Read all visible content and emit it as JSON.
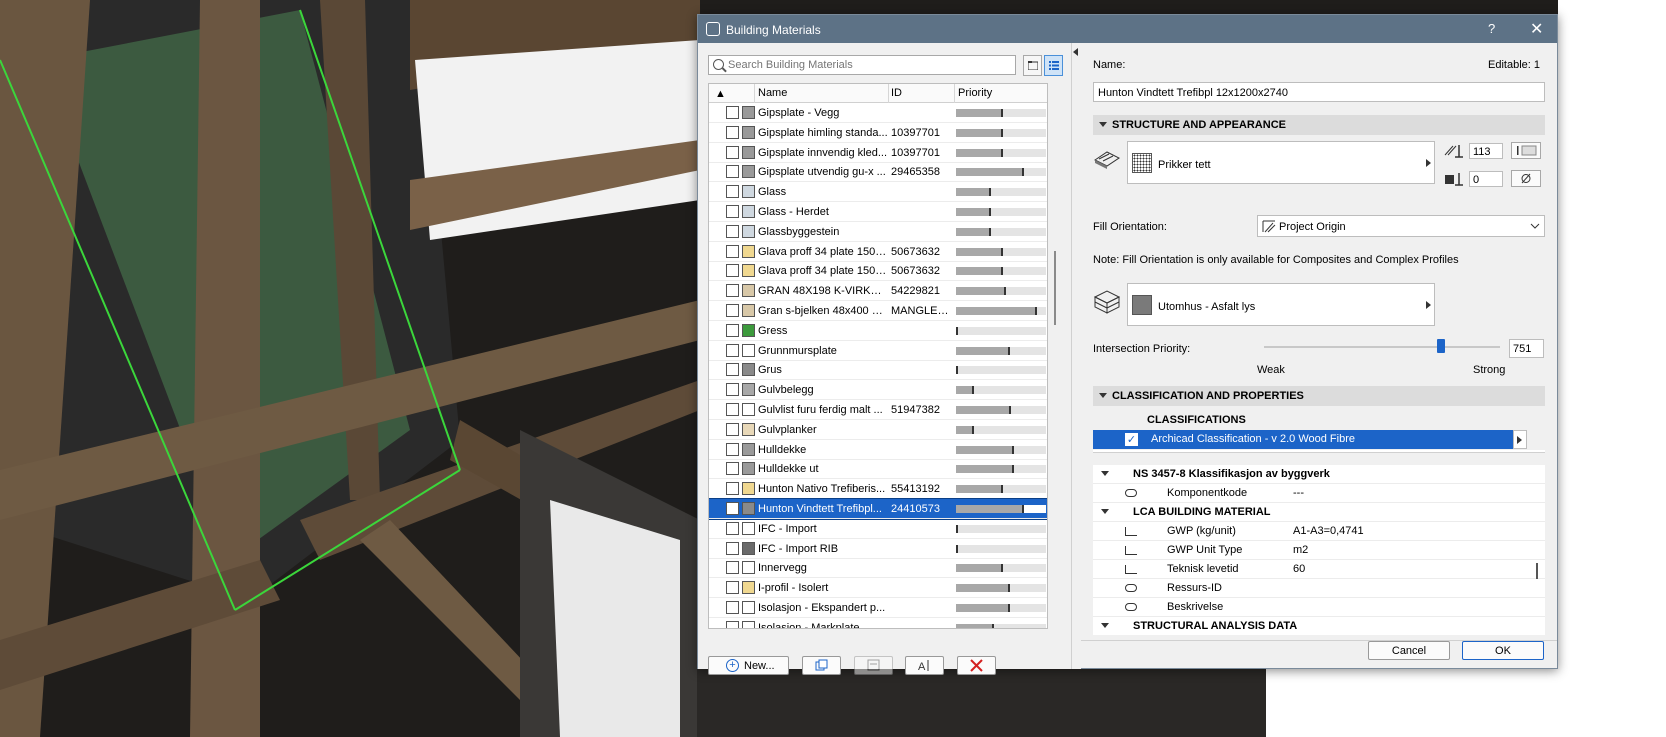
{
  "window": {
    "title": "Building Materials",
    "help": "?",
    "close": "✕"
  },
  "search": {
    "placeholder": "Search Building Materials"
  },
  "list": {
    "headers": {
      "name": "Name",
      "id": "ID",
      "priority": "Priority"
    },
    "rows": [
      {
        "name": "Gipsplate - Vegg",
        "id": "",
        "priority": 0.52,
        "color": "#9a9a9a"
      },
      {
        "name": "Gipsplate himling standa...",
        "id": "10397701",
        "priority": 0.52,
        "color": "#9a9a9a"
      },
      {
        "name": "Gipsplate innvendig kled...",
        "id": "10397701",
        "priority": 0.52,
        "color": "#9a9a9a"
      },
      {
        "name": "Gipsplate utvendig gu-x ...",
        "id": "29465358",
        "priority": 0.75,
        "color": "#9a9a9a"
      },
      {
        "name": "Glass",
        "id": "",
        "priority": 0.39,
        "color": "#cfd8e0"
      },
      {
        "name": "Glass - Herdet",
        "id": "",
        "priority": 0.39,
        "color": "#cfd8e0"
      },
      {
        "name": "Glassbyggestein",
        "id": "",
        "priority": 0.39,
        "color": "#cfd8e0"
      },
      {
        "name": "Glava proff 34 plate 150x...",
        "id": "50673632",
        "priority": 0.52,
        "color": "#f0d890"
      },
      {
        "name": "Glava proff 34 plate 150x...",
        "id": "50673632",
        "priority": 0.52,
        "color": "#f0d890"
      },
      {
        "name": "GRAN 48X198 K-VIRKE C24",
        "id": "54229821",
        "priority": 0.55,
        "color": "#d8c8a8"
      },
      {
        "name": "Gran s-bjelken 48x400 gl...",
        "id": "MANGLER ...",
        "priority": 0.9,
        "color": "#d8c8a8"
      },
      {
        "name": "Gress",
        "id": "",
        "priority": 0.01,
        "color": "#3c9a3c"
      },
      {
        "name": "Grunnmursplate",
        "id": "",
        "priority": 0.6,
        "color": "#ffffff"
      },
      {
        "name": "Grus",
        "id": "",
        "priority": 0.01,
        "color": "#8a8a8a"
      },
      {
        "name": "Gulvbelegg",
        "id": "",
        "priority": 0.2,
        "color": "#a8a8a8"
      },
      {
        "name": "Gulvlist furu ferdig malt ...",
        "id": "51947382",
        "priority": 0.61,
        "color": "#ffffff"
      },
      {
        "name": "Gulvplanker",
        "id": "",
        "priority": 0.2,
        "color": "#e8d8b8"
      },
      {
        "name": "Hulldekke",
        "id": "",
        "priority": 0.64,
        "color": "#9a9a9a"
      },
      {
        "name": "Hulldekke ut",
        "id": "",
        "priority": 0.64,
        "color": "#9a9a9a"
      },
      {
        "name": "Hunton Nativo Trefiberis...",
        "id": "55413192",
        "priority": 0.52,
        "color": "#f0d890"
      },
      {
        "name": "Hunton Vindtett Trefibpl...",
        "id": "24410573",
        "priority": 0.75,
        "color": "#8a8a8a"
      },
      {
        "name": "IFC - Import",
        "id": "",
        "priority": 0.01,
        "color": "#ffffff"
      },
      {
        "name": "IFC - Import RIB",
        "id": "",
        "priority": 0.01,
        "color": "#6a6a6a"
      },
      {
        "name": "Innervegg",
        "id": "",
        "priority": 0.52,
        "color": "#ffffff"
      },
      {
        "name": "I-profil - Isolert",
        "id": "",
        "priority": 0.6,
        "color": "#f0d890"
      },
      {
        "name": "Isolasjon - Ekspandert p...",
        "id": "",
        "priority": 0.6,
        "color": "#ffffff"
      },
      {
        "name": "Isolasjon - Markplate",
        "id": "",
        "priority": 0.42,
        "color": "#ffffff"
      }
    ],
    "selected_index": 20
  },
  "bottom_buttons": {
    "new": "New..."
  },
  "details": {
    "name_label": "Name:",
    "editable_label": "Editable: 1",
    "name_value": "Hunton Vindtett Trefibpl 12x1200x2740",
    "structure_section": "STRUCTURE AND APPEARANCE",
    "fill_name": "Prikker tett",
    "pen_value": "113",
    "bg_value": "0",
    "fill_orientation_label": "Fill Orientation:",
    "fill_orientation_value": "Project Origin",
    "note": "Note: Fill Orientation is only available for Composites and Complex Profiles",
    "surface_name": "Utomhus - Asfalt lys",
    "intersection_label": "Intersection Priority:",
    "intersection_value": "751",
    "intersection_level": 0.751,
    "weak": "Weak",
    "strong": "Strong",
    "classification_section": "CLASSIFICATION AND PROPERTIES",
    "classifications_header": "CLASSIFICATIONS",
    "classification_item": "Archicad Classification - v 2.0 Wood Fibre",
    "props": [
      {
        "type": "group",
        "k": "NS 3457-8 Klassifikasjon av byggverk",
        "v": ""
      },
      {
        "type": "link",
        "k": "Komponentkode",
        "v": "---"
      },
      {
        "type": "group",
        "k": "LCA BUILDING MATERIAL",
        "v": ""
      },
      {
        "type": "tree",
        "k": "GWP (kg/unit)",
        "v": "A1-A3=0,4741"
      },
      {
        "type": "tree",
        "k": "GWP Unit Type",
        "v": "m2"
      },
      {
        "type": "tree",
        "k": "Teknisk levetid",
        "v": " 60"
      },
      {
        "type": "link",
        "k": "Ressurs-ID",
        "v": ""
      },
      {
        "type": "link",
        "k": "Beskrivelse",
        "v": ""
      },
      {
        "type": "group",
        "k": "STRUCTURAL ANALYSIS DATA",
        "v": ""
      }
    ]
  },
  "footer": {
    "cancel": "Cancel",
    "ok": "OK"
  },
  "colors": {
    "titlebar": "#5d7286",
    "selection": "#1c64c8"
  }
}
